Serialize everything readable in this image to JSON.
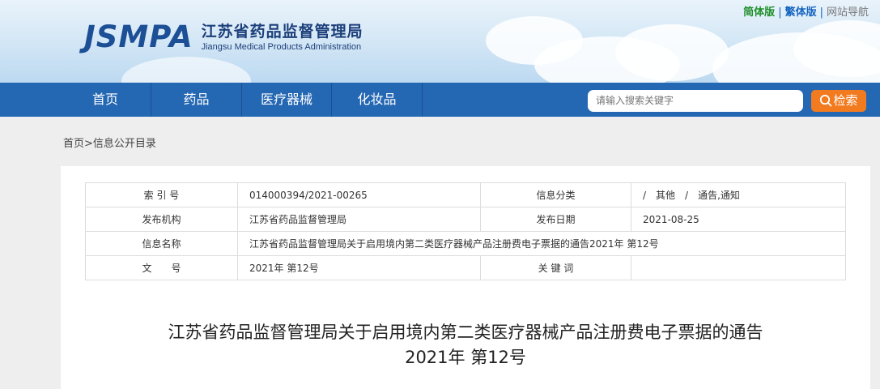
{
  "header": {
    "logo_mark": "JSMPA",
    "logo_cn": "江苏省药品监督管理局",
    "logo_en": "Jiangsu Medical Products Administration",
    "top_links": {
      "simplified": "简体版",
      "traditional": "繁体版",
      "site_nav": "网站导航",
      "sep": "|"
    }
  },
  "nav": {
    "items": [
      {
        "label": "首页"
      },
      {
        "label": "药品"
      },
      {
        "label": "医疗器械"
      },
      {
        "label": "化妆品"
      }
    ],
    "search_placeholder": "请输入搜索关键字",
    "search_button": "检索"
  },
  "breadcrumb": {
    "home": "首页",
    "sep": ">",
    "current": "信息公开目录"
  },
  "meta": {
    "index_label": "索 引 号",
    "index_value": "014000394/2021-00265",
    "category_label": "信息分类",
    "category_value": "/　其他　/　通告,通知",
    "publisher_label": "发布机构",
    "publisher_value": "江苏省药品监督管理局",
    "date_label": "发布日期",
    "date_value": "2021-08-25",
    "name_label": "信息名称",
    "name_value": "江苏省药品监督管理局关于启用境内第二类医疗器械产品注册费电子票据的通告2021年 第12号",
    "docno_label": "文　　号",
    "docno_value": "2021年 第12号",
    "keywords_label": "关 键 词",
    "keywords_value": ""
  },
  "article": {
    "title_line1": "江苏省药品监督管理局关于启用境内第二类医疗器械产品注册费电子票据的通告",
    "title_line2": "2021年 第12号"
  },
  "colors": {
    "nav_bg": "#2467b3",
    "search_button": "#f27b1f",
    "logo": "#1c4f95"
  }
}
